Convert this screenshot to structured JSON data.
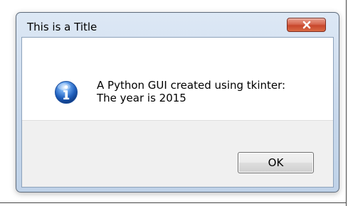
{
  "window": {
    "title": "This is a Title",
    "close_icon": "close-icon"
  },
  "message": {
    "icon": "info-icon",
    "line1": "A Python GUI created using tkinter:",
    "line2": "The year is 2015"
  },
  "buttons": {
    "ok_label": "OK"
  },
  "colors": {
    "title_bar": "#c9d9ec",
    "close_button": "#c8462c",
    "info_icon": "#1f5fbd"
  }
}
